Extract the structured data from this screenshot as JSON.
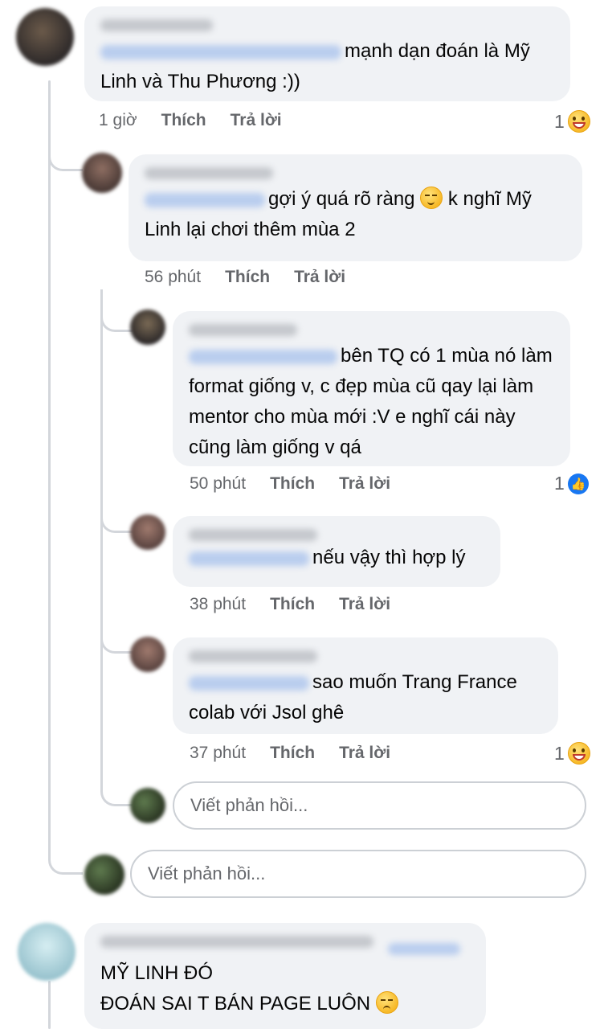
{
  "comments": [
    {
      "id": "c1",
      "text": "mạnh dạn đoán là Mỹ Linh và Thu Phương :))",
      "time": "1 giờ",
      "like": "Thích",
      "reply": "Trả lời",
      "reaction_count": "1",
      "reaction_icon": "grin-icon"
    },
    {
      "id": "c2",
      "text_before": "gợi ý quá rõ ràng",
      "emoji_icon": "relieved-face-icon",
      "text_after": "k nghĩ Mỹ Linh lại chơi thêm mùa 2",
      "time": "56 phút",
      "like": "Thích",
      "reply": "Trả lời"
    },
    {
      "id": "c3",
      "text": "bên TQ có 1 mùa nó làm format giống v, c đẹp mùa cũ qay lại làm mentor cho mùa mới :V e nghĩ cái này cũng làm giống v qá",
      "time": "50 phút",
      "like": "Thích",
      "reply": "Trả lời",
      "reaction_count": "1",
      "reaction_icon": "like-icon"
    },
    {
      "id": "c4",
      "text": "nếu vậy thì hợp lý",
      "time": "38 phút",
      "like": "Thích",
      "reply": "Trả lời"
    },
    {
      "id": "c5",
      "text": "sao muốn Trang France colab với Jsol ghê",
      "time": "37 phút",
      "like": "Thích",
      "reply": "Trả lời",
      "reaction_count": "1",
      "reaction_icon": "grin-icon"
    },
    {
      "id": "c6",
      "line1": "MỸ LINH ĐÓ",
      "line2_before": "ĐOÁN SAI T BÁN PAGE LUÔN",
      "emoji_icon": "disappointed-face-icon"
    }
  ],
  "reply_boxes": [
    {
      "placeholder": "Viết phản hồi..."
    },
    {
      "placeholder": "Viết phản hồi..."
    }
  ],
  "colors": {
    "bubble": "#f0f2f5",
    "meta": "#65676b",
    "like_blue": "#1877f2",
    "thread": "#d3d6db"
  }
}
